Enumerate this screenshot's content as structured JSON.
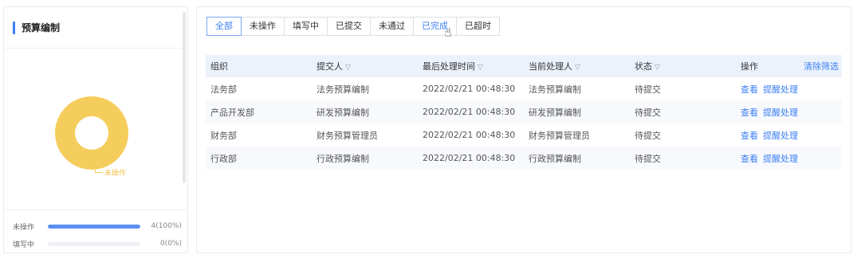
{
  "left": {
    "title": "预算编制",
    "donut_label": "未操作",
    "stats": [
      {
        "name": "未操作",
        "value": "4(100%)",
        "fraction": 1.0
      },
      {
        "name": "填写中",
        "value": "0(0%)",
        "fraction": 0.0
      }
    ]
  },
  "tabs": [
    "全部",
    "未操作",
    "填写中",
    "已提交",
    "未通过",
    "已完成",
    "已超时"
  ],
  "table": {
    "headers": {
      "org": "组织",
      "submitter": "提交人",
      "last_time": "最后处理时间",
      "handler": "当前处理人",
      "status": "状态",
      "ops": "操作",
      "clear": "清除筛选"
    },
    "filter_icon": "▽",
    "rows": [
      {
        "org": "法务部",
        "submitter": "法务预算编制",
        "time": "2022/02/21 00:48:30",
        "handler": "法务预算编制",
        "status": "待提交",
        "view": "查看",
        "remind": "提醒处理"
      },
      {
        "org": "产品开发部",
        "submitter": "研发预算编制",
        "time": "2022/02/21 00:48:30",
        "handler": "研发预算编制",
        "status": "待提交",
        "view": "查看",
        "remind": "提醒处理"
      },
      {
        "org": "财务部",
        "submitter": "财务预算管理员",
        "time": "2022/02/21 00:48:30",
        "handler": "财务预算管理员",
        "status": "待提交",
        "view": "查看",
        "remind": "提醒处理"
      },
      {
        "org": "行政部",
        "submitter": "行政预算编制",
        "time": "2022/02/21 00:48:30",
        "handler": "行政预算编制",
        "status": "待提交",
        "view": "查看",
        "remind": "提醒处理"
      }
    ]
  },
  "colors": {
    "accent": "#3b7ff3",
    "donut": "#f5cd5c",
    "header_bg": "#ecf2fb"
  }
}
